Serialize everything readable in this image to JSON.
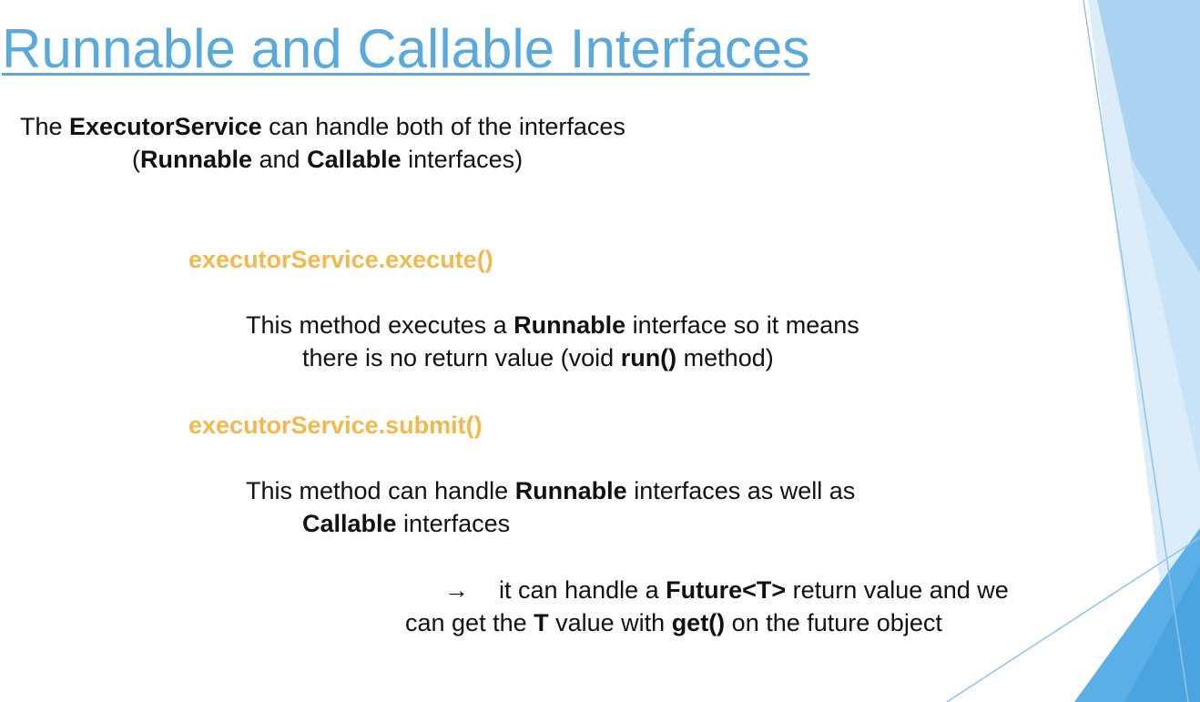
{
  "slide": {
    "title": "Runnable and Callable Interfaces",
    "intro": {
      "line1": {
        "t1": "The ",
        "b1": "ExecutorService",
        "t2": " can handle both of the interfaces"
      },
      "line2": {
        "t1": "(",
        "b1": "Runnable",
        "t2": " and ",
        "b2": "Callable",
        "t3": " interfaces)"
      }
    },
    "execute": {
      "method": "executorService.execute()",
      "desc_line1": {
        "t1": "This method executes a ",
        "b1": "Runnable",
        "t2": " interface so it means"
      },
      "desc_line2": {
        "t1": "there is no return value (void ",
        "b1": "run()",
        "t2": " method)"
      }
    },
    "submit": {
      "method": "executorService.submit()",
      "desc_line1": {
        "t1": "This method can handle ",
        "b1": "Runnable",
        "t2": " interfaces as well as"
      },
      "desc_line2": {
        "b1": "Callable",
        "t1": " interfaces"
      },
      "note_line1": {
        "arrow": "→",
        "t1": "it can handle a ",
        "b1": "Future<T>",
        "t2": " return value and we"
      },
      "note_line2": {
        "t1": "can get the ",
        "b1": "T",
        "t2": " value with ",
        "b2": "get()",
        "t3": " on the future object"
      }
    },
    "colors": {
      "title": "#5aa9dd",
      "method": "#f2b84b",
      "text": "#111111",
      "decor_light": "#cfe6f7",
      "decor_mid": "#9fcdef",
      "decor_dark": "#5ab0e6"
    }
  }
}
